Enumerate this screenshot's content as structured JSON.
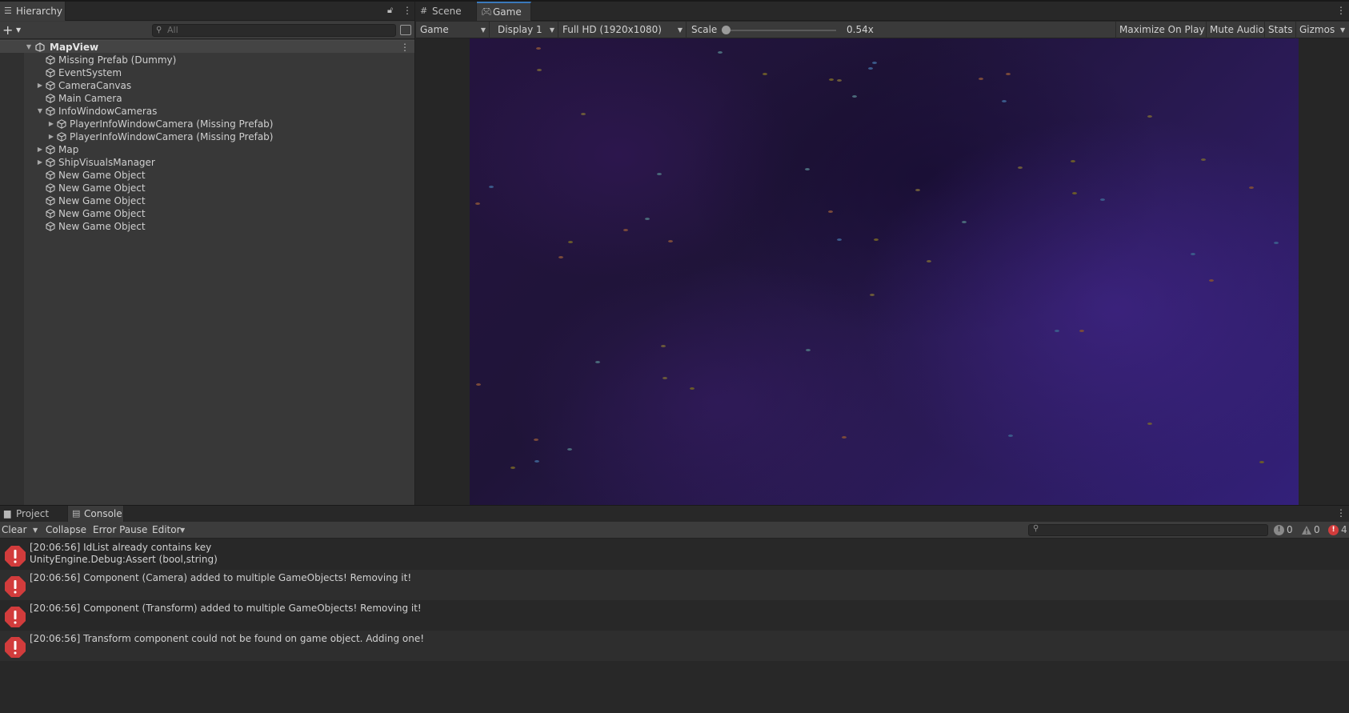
{
  "hierarchy": {
    "tab_label": "Hierarchy",
    "search_placeholder": "All",
    "scene_name": "MapView",
    "items": [
      {
        "label": "Missing Prefab (Dummy)",
        "depth": 1,
        "expander": ""
      },
      {
        "label": "EventSystem",
        "depth": 1,
        "expander": ""
      },
      {
        "label": "CameraCanvas",
        "depth": 1,
        "expander": "▶"
      },
      {
        "label": "Main Camera",
        "depth": 1,
        "expander": ""
      },
      {
        "label": "InfoWindowCameras",
        "depth": 1,
        "expander": "▼"
      },
      {
        "label": "PlayerInfoWindowCamera (Missing Prefab)",
        "depth": 2,
        "expander": "▶"
      },
      {
        "label": "PlayerInfoWindowCamera (Missing Prefab)",
        "depth": 2,
        "expander": "▶"
      },
      {
        "label": "Map",
        "depth": 1,
        "expander": "▶"
      },
      {
        "label": "ShipVisualsManager",
        "depth": 1,
        "expander": "▶"
      },
      {
        "label": "New Game Object",
        "depth": 1,
        "expander": ""
      },
      {
        "label": "New Game Object",
        "depth": 1,
        "expander": ""
      },
      {
        "label": "New Game Object",
        "depth": 1,
        "expander": ""
      },
      {
        "label": "New Game Object",
        "depth": 1,
        "expander": ""
      },
      {
        "label": "New Game Object",
        "depth": 1,
        "expander": ""
      }
    ]
  },
  "game_view": {
    "tabs": {
      "scene": "Scene",
      "game": "Game"
    },
    "view_mode": "Game",
    "display": "Display 1",
    "resolution": "Full HD (1920x1080)",
    "scale_label": "Scale",
    "scale_value": "0.54x",
    "scale_fraction": 0.0,
    "buttons": {
      "maximize": "Maximize On Play",
      "mute": "Mute Audio",
      "stats": "Stats",
      "gizmos": "Gizmos"
    }
  },
  "console": {
    "tabs": {
      "project": "Project",
      "console": "Console"
    },
    "buttons": {
      "clear": "Clear",
      "collapse": "Collapse",
      "error_pause": "Error Pause",
      "editor": "Editor"
    },
    "counts": {
      "info": "0",
      "warning": "0",
      "error": "4"
    },
    "logs": [
      {
        "line1": "[20:06:56] IdList already contains key",
        "line2": "UnityEngine.Debug:Assert (bool,string)"
      },
      {
        "line1": "[20:06:56] Component (Camera) added to multiple GameObjects! Removing it!",
        "line2": ""
      },
      {
        "line1": "[20:06:56] Component (Transform) added to multiple GameObjects! Removing it!",
        "line2": ""
      },
      {
        "line1": "[20:06:56] Transform component could not be found on game object. Adding one!",
        "line2": ""
      }
    ]
  },
  "colors": {
    "error": "#d23c3c",
    "tab_highlight": "#3a79bb",
    "panel": "#383838"
  }
}
